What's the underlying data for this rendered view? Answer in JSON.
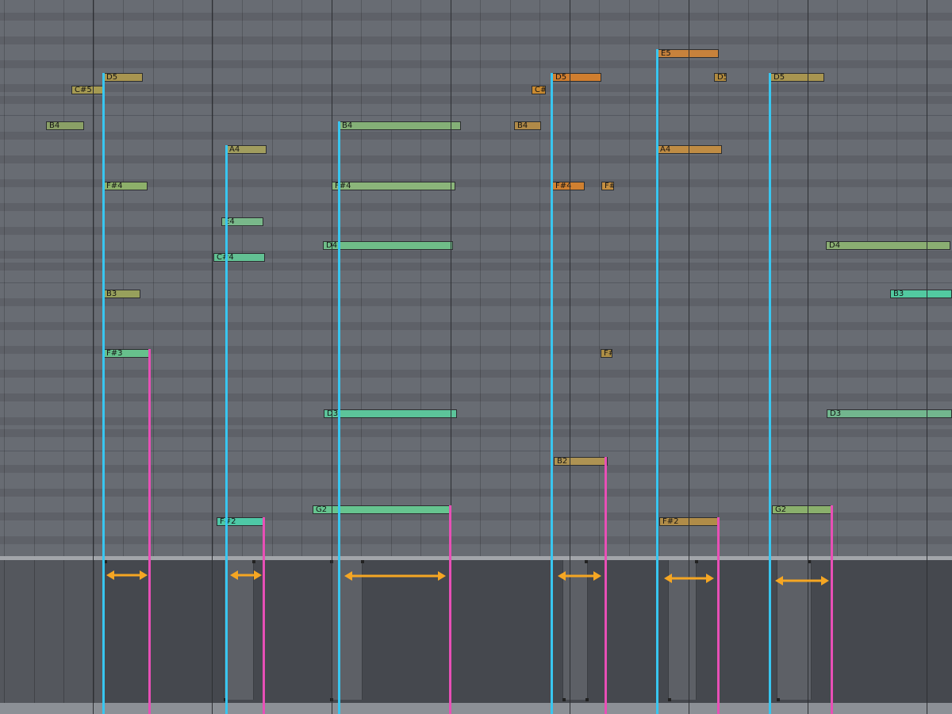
{
  "notes": [
    {
      "label": "E5",
      "color": "#c7823c"
    },
    {
      "label": "D5",
      "color": "#a89550"
    },
    {
      "label": "D5",
      "color": "#d07e2f"
    },
    {
      "label": "D5",
      "color": "#b08a3f"
    },
    {
      "label": "D5",
      "color": "#a89550"
    },
    {
      "label": "C#5",
      "color": "#a59a52"
    },
    {
      "label": "C#",
      "color": "#c98a30"
    },
    {
      "label": "B4",
      "color": "#8aa066"
    },
    {
      "label": "B4",
      "color": "#84b077"
    },
    {
      "label": "B4",
      "color": "#b08a48"
    },
    {
      "label": "A4",
      "color": "#a19d5e"
    },
    {
      "label": "A4",
      "color": "#bf8c44"
    },
    {
      "label": "F#4",
      "color": "#8db06a"
    },
    {
      "label": "F#4",
      "color": "#8bb57a"
    },
    {
      "label": "F#4",
      "color": "#d08030"
    },
    {
      "label": "F#",
      "color": "#c58f40"
    },
    {
      "label": "E4",
      "color": "#79b88a"
    },
    {
      "label": "D4",
      "color": "#6fbd88"
    },
    {
      "label": "D4",
      "color": "#8aae72"
    },
    {
      "label": "C#4",
      "color": "#62c193"
    },
    {
      "label": "B3",
      "color": "#97a05c"
    },
    {
      "label": "B3",
      "color": "#52c9a0"
    },
    {
      "label": "F#3",
      "color": "#67c08c"
    },
    {
      "label": "F#",
      "color": "#ad8e45"
    },
    {
      "label": "D3",
      "color": "#5cc49a"
    },
    {
      "label": "D3",
      "color": "#72b68e"
    },
    {
      "label": "B2",
      "color": "#ae9353"
    },
    {
      "label": "G2",
      "color": "#66c48f"
    },
    {
      "label": "G2",
      "color": "#8ab06c"
    },
    {
      "label": "F#2",
      "color": "#4ec8a6"
    },
    {
      "label": "F#2",
      "color": "#b08c48"
    }
  ],
  "colors": {
    "note_start_marker": "#38c6f0",
    "note_end_marker": "#e84fb6",
    "duration_arrow": "#f5a623"
  }
}
